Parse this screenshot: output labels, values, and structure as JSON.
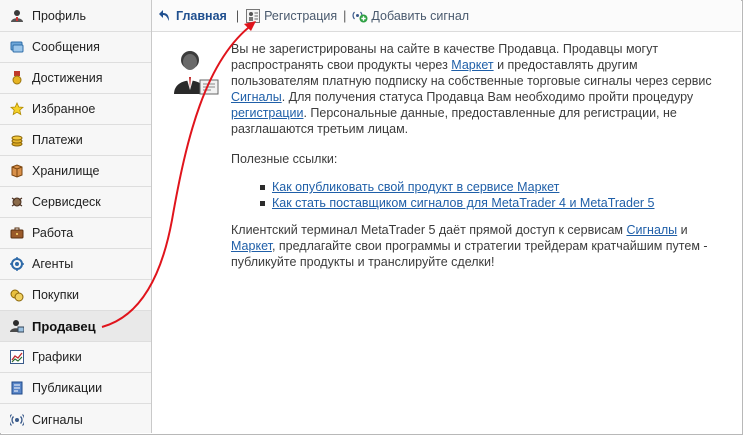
{
  "sidebar": {
    "items": [
      {
        "label": "Профиль",
        "icon": "person-icon"
      },
      {
        "label": "Сообщения",
        "icon": "message-icon"
      },
      {
        "label": "Достижения",
        "icon": "medal-icon"
      },
      {
        "label": "Избранное",
        "icon": "star-icon"
      },
      {
        "label": "Платежи",
        "icon": "coins-icon"
      },
      {
        "label": "Хранилище",
        "icon": "storage-icon"
      },
      {
        "label": "Сервисдеск",
        "icon": "servicedesk-icon"
      },
      {
        "label": "Работа",
        "icon": "briefcase-icon"
      },
      {
        "label": "Агенты",
        "icon": "agents-icon"
      },
      {
        "label": "Покупки",
        "icon": "purchases-icon"
      },
      {
        "label": "Продавец",
        "icon": "seller-icon",
        "active": true
      },
      {
        "label": "Графики",
        "icon": "chart-icon"
      },
      {
        "label": "Публикации",
        "icon": "publications-icon"
      },
      {
        "label": "Сигналы",
        "icon": "signals-icon"
      }
    ]
  },
  "toolbar": {
    "home_label": "Главная",
    "separator": "|",
    "registration_label": "Регистрация",
    "add_signal_label": "Добавить сигнал"
  },
  "content": {
    "intro_1": "Вы не зарегистрированы на сайте в качестве Продавца. Продавцы могут распространять свои продукты через ",
    "intro_link_market": "Маркет",
    "intro_2": " и предоставлять другим пользователям платную подписку на собственные торговые сигналы через сервис ",
    "intro_link_signals": "Сигналы",
    "intro_3": ". Для получения статуса Продавца Вам необходимо пройти процедуру ",
    "intro_link_registration": "регистрации",
    "intro_4": ". Персональные данные, предоставленные для регистрации, не разглашаются третьим лицам.",
    "useful_links_title": "Полезные ссылки:",
    "useful_links": [
      "Как опубликовать свой продукт в сервисе Маркет",
      "Как стать поставщиком сигналов для MetaTrader 4 и MetaTrader 5"
    ],
    "footer_1": "Клиентский терминал MetaTrader 5 даёт прямой доступ к сервисам ",
    "footer_link_signals": "Сигналы",
    "footer_2": " и ",
    "footer_link_market": "Маркет",
    "footer_3": ", предлагайте свои программы и стратегии трейдерам кратчайшим путем - публикуйте продукты и транслируйте сделки!"
  },
  "colors": {
    "link": "#1f5fa8",
    "annotation_arrow": "#e0141c",
    "sidebar_bg": "#f7f7f7"
  }
}
